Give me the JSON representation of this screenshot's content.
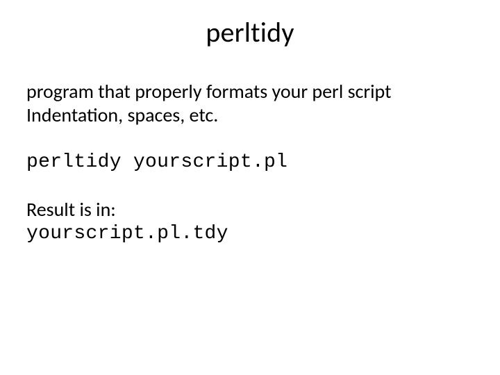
{
  "title": "perltidy",
  "body": {
    "line1": "program that properly formats your perl script",
    "line2": "Indentation,  spaces, etc.",
    "command": "perltidy yourscript.pl",
    "result_label": "Result is in:",
    "result_file": "yourscript.pl.tdy"
  }
}
